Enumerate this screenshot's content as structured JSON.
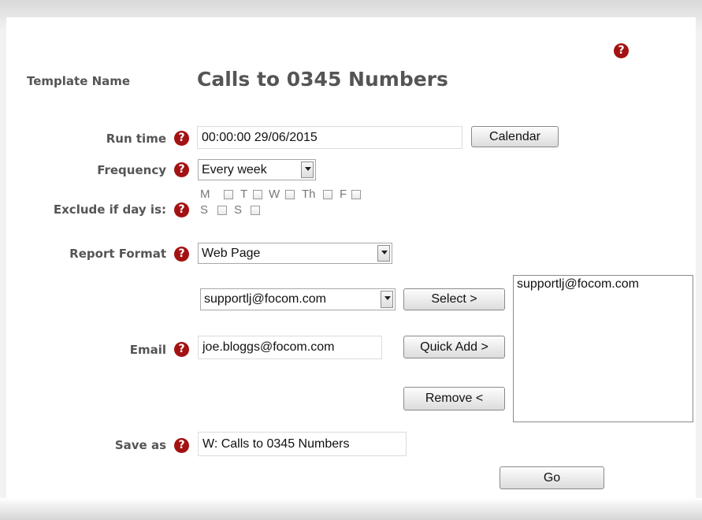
{
  "template_name_label": "Template Name",
  "template_name_value": "Calls to 0345 Numbers",
  "run_time": {
    "label": "Run time",
    "value": "00:00:00 29/06/2015",
    "calendar_button": "Calendar"
  },
  "frequency": {
    "label": "Frequency",
    "selected": "Every week"
  },
  "exclude": {
    "label": "Exclude if day is:",
    "days": [
      "M",
      "T",
      "W",
      "Th",
      "F",
      "S",
      "S"
    ]
  },
  "report_format": {
    "label": "Report Format",
    "selected": "Web Page"
  },
  "email": {
    "label": "Email",
    "select_value": "supportlj@focom.com",
    "select_button": "Select >",
    "input_value": "joe.bloggs@focom.com",
    "quick_add_button": "Quick Add >",
    "remove_button": "Remove <",
    "recipients": [
      "supportlj@focom.com"
    ]
  },
  "save_as": {
    "label": "Save as",
    "value": "W: Calls to 0345 Numbers"
  },
  "go_button": "Go",
  "help_glyph": "?",
  "colors": {
    "help_icon": "#a31212",
    "label_text": "#555555"
  }
}
